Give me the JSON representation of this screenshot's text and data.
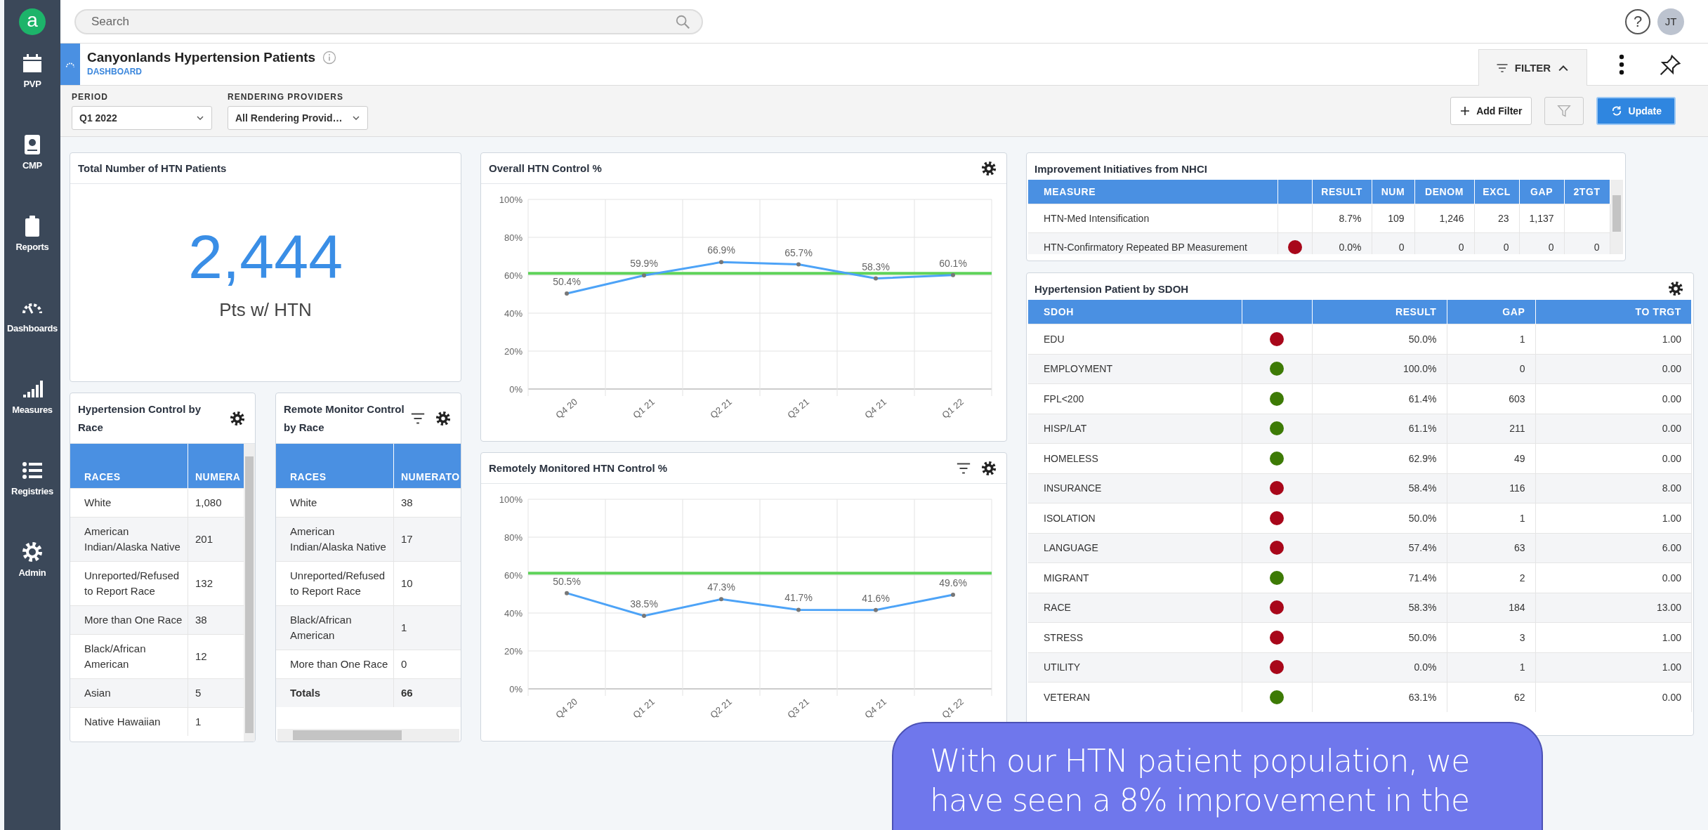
{
  "sidebar": {
    "logo": "a",
    "items": [
      {
        "label": "PVP",
        "kind": "calendar"
      },
      {
        "label": "CMP",
        "kind": "badge"
      },
      {
        "label": "Reports",
        "kind": "clipboard"
      },
      {
        "label": "Dashboards",
        "kind": "gauge"
      },
      {
        "label": "Measures",
        "kind": "bars"
      },
      {
        "label": "Registries",
        "kind": "list"
      },
      {
        "label": "Admin",
        "kind": "gear"
      }
    ]
  },
  "search": {
    "placeholder": "Search"
  },
  "help": "?",
  "avatar": "JT",
  "header": {
    "title": "Canyonlands Hypertension Patients",
    "subtitle": "DASHBOARD",
    "filter_tab": {
      "label": "FILTER",
      "expanded": true
    }
  },
  "filters": [
    {
      "label": "PERIOD",
      "value": "Q1 2022"
    },
    {
      "label": "RENDERING PROVIDERS",
      "value": "All Rendering Provid…"
    }
  ],
  "actions": {
    "add_filter": "Add Filter",
    "filter_disabled": true,
    "update": "Update"
  },
  "total_card": {
    "title": "Total Number of HTN Patients",
    "value": "2,444",
    "caption": "Pts w/ HTN"
  },
  "race_control": {
    "title": "Hypertension Control by Race",
    "columns": [
      "RACES",
      "NUMERA"
    ],
    "rows": [
      [
        "White",
        "1,080"
      ],
      [
        "American Indian/Alaska Native",
        "201"
      ],
      [
        "Unreported/Refused to Report Race",
        "132"
      ],
      [
        "More than One Race",
        "38"
      ],
      [
        "Black/African American",
        "12"
      ],
      [
        "Asian",
        "5"
      ],
      [
        "Native Hawaiian",
        "1"
      ]
    ]
  },
  "remote_race": {
    "title": "Remote Monitor Control by Race",
    "columns": [
      "RACES",
      "NUMERATO"
    ],
    "rows": [
      [
        "White",
        "38"
      ],
      [
        "American Indian/Alaska Native",
        "17"
      ],
      [
        "Unreported/Refused to Report Race",
        "10"
      ],
      [
        "Black/African American",
        "1"
      ],
      [
        "More than One Race",
        "0"
      ]
    ],
    "totals": [
      "Totals",
      "66"
    ]
  },
  "overall_chart": {
    "title": "Overall HTN Control %",
    "chart_data": {
      "type": "line",
      "grid": true,
      "categories": [
        "Q4 20",
        "Q1 21",
        "Q2 21",
        "Q3 21",
        "Q4 21",
        "Q1 22"
      ],
      "ylim": [
        0,
        100
      ],
      "yticks": [
        {
          "value": 0,
          "label": "0%"
        },
        {
          "value": 20,
          "label": "20%"
        },
        {
          "value": 40,
          "label": "40%"
        },
        {
          "value": 60,
          "label": "60%"
        },
        {
          "value": 80,
          "label": "80%"
        },
        {
          "value": 100,
          "label": "100%"
        }
      ],
      "value_labels": [
        "50.4%",
        "59.9%",
        "66.9%",
        "65.7%",
        "58.3%",
        "60.1%"
      ],
      "ref_lines": [
        {
          "axis": "y",
          "value": 61,
          "color": "#5fd35a"
        }
      ],
      "series": [
        {
          "color": "#4da3f7",
          "marker": true,
          "values": [
            50.4,
            59.9,
            66.9,
            65.7,
            58.3,
            60.1
          ]
        }
      ]
    }
  },
  "remote_chart": {
    "title": "Remotely Monitored HTN Control %",
    "chart_data": {
      "type": "line",
      "grid": true,
      "categories": [
        "Q4 20",
        "Q1 21",
        "Q2 21",
        "Q3 21",
        "Q4 21",
        "Q1 22"
      ],
      "ylim": [
        0,
        100
      ],
      "yticks": [
        {
          "value": 0,
          "label": "0%"
        },
        {
          "value": 20,
          "label": "20%"
        },
        {
          "value": 40,
          "label": "40%"
        },
        {
          "value": 60,
          "label": "60%"
        },
        {
          "value": 80,
          "label": "80%"
        },
        {
          "value": 100,
          "label": "100%"
        }
      ],
      "value_labels": [
        "50.5%",
        "38.5%",
        "47.3%",
        "41.7%",
        "41.6%",
        "49.6%"
      ],
      "ref_lines": [
        {
          "axis": "y",
          "value": 61,
          "color": "#5fd35a"
        }
      ],
      "series": [
        {
          "color": "#4da3f7",
          "marker": true,
          "values": [
            50.5,
            38.5,
            47.3,
            41.7,
            41.6,
            49.6
          ]
        }
      ]
    }
  },
  "initiatives": {
    "title": "Improvement Initiatives from NHCI",
    "columns": [
      "MEASURE",
      "",
      "RESULT",
      "NUM",
      "DENOM",
      "EXCL",
      "GAP",
      "2TGT"
    ],
    "rows": [
      {
        "cells": [
          "HTN-Med Intensification",
          "",
          "8.7%",
          "109",
          "1,246",
          "23",
          "1,137",
          ""
        ]
      },
      {
        "color": "#a8071a",
        "cells": [
          "HTN-Confirmatory Repeated BP Measurement",
          "",
          "0.0%",
          "0",
          "0",
          "0",
          "0",
          "0"
        ]
      }
    ]
  },
  "sdoh": {
    "title": "Hypertension Patient by SDOH",
    "columns": [
      "SDOH",
      "RESULT",
      "GAP",
      "TO TRGT"
    ],
    "rows": [
      {
        "name": "EDU",
        "color": "#a8071a",
        "result": "50.0%",
        "gap": "1",
        "to_target": "1.00"
      },
      {
        "name": "EMPLOYMENT",
        "color": "#3d7a05",
        "result": "100.0%",
        "gap": "0",
        "to_target": "0.00"
      },
      {
        "name": "FPL<200",
        "color": "#3d7a05",
        "result": "61.4%",
        "gap": "603",
        "to_target": "0.00"
      },
      {
        "name": "HISP/LAT",
        "color": "#3d7a05",
        "result": "61.1%",
        "gap": "211",
        "to_target": "0.00"
      },
      {
        "name": "HOMELESS",
        "color": "#3d7a05",
        "result": "62.9%",
        "gap": "49",
        "to_target": "0.00"
      },
      {
        "name": "INSURANCE",
        "color": "#a8071a",
        "result": "58.4%",
        "gap": "116",
        "to_target": "8.00"
      },
      {
        "name": "ISOLATION",
        "color": "#a8071a",
        "result": "50.0%",
        "gap": "1",
        "to_target": "1.00"
      },
      {
        "name": "LANGUAGE",
        "color": "#a8071a",
        "result": "57.4%",
        "gap": "63",
        "to_target": "6.00"
      },
      {
        "name": "MIGRANT",
        "color": "#3d7a05",
        "result": "71.4%",
        "gap": "2",
        "to_target": "0.00"
      },
      {
        "name": "RACE",
        "color": "#a8071a",
        "result": "58.3%",
        "gap": "184",
        "to_target": "13.00"
      },
      {
        "name": "STRESS",
        "color": "#a8071a",
        "result": "50.0%",
        "gap": "3",
        "to_target": "1.00"
      },
      {
        "name": "UTILITY",
        "color": "#a8071a",
        "result": "0.0%",
        "gap": "1",
        "to_target": "1.00"
      },
      {
        "name": "VETERAN",
        "color": "#3d7a05",
        "result": "63.1%",
        "gap": "62",
        "to_target": "0.00"
      }
    ]
  },
  "callout": {
    "lines": [
      "With our HTN patient population, we",
      "have seen a 8% improvement in the"
    ]
  }
}
